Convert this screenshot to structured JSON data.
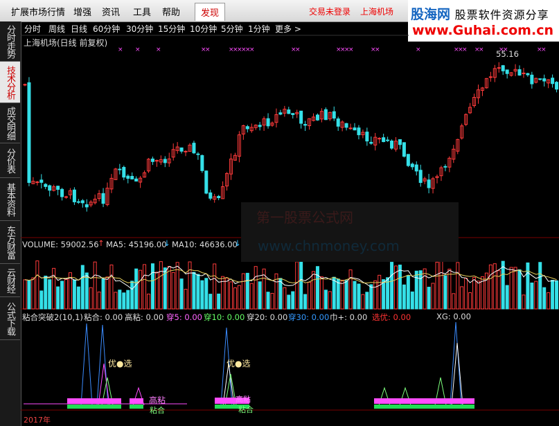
{
  "menu": {
    "items": [
      "扩展市场行情",
      "增强",
      "资讯",
      "工具",
      "帮助"
    ],
    "active": "发现",
    "links": [
      "交易未登录",
      "上海机场"
    ]
  },
  "logo": {
    "brand": "股海网",
    "tagline": "股票软件资源分享",
    "url": "www.Guhai.com.cn"
  },
  "sidebar": {
    "tabs": [
      "分时走势",
      "技术分析",
      "成交明细",
      "分价表",
      "基本资料",
      "东方财富",
      "云财经",
      "公式下载"
    ],
    "active_index": 1
  },
  "periods": {
    "items": [
      "分时",
      "周线",
      "日线",
      "60分钟",
      "30分钟",
      "15分钟",
      "10分钟",
      "5分钟",
      "1分钟",
      "更多 >"
    ],
    "active_index": 0
  },
  "chart": {
    "title": "上海机场(日线 前复权)",
    "high_label": "55.16",
    "colors": {
      "up": "#ff3b3b",
      "down": "#35e0e8",
      "ma5": "#ffffff",
      "ma10": "#e6cf5a",
      "signal": "#ff4dff"
    }
  },
  "volume": {
    "label": "VOLUME: 59002.56",
    "ma5": "MA5: 45196.00",
    "ma10": "MA10: 46636.00"
  },
  "indicator": {
    "name": "粘合突破2(10,1)",
    "items": [
      {
        "label": "粘合: 0.00",
        "color": "#dddddd"
      },
      {
        "label": "高粘: 0.00",
        "color": "#dddddd"
      },
      {
        "label": "穿5: 0.00",
        "color": "#ff66ff"
      },
      {
        "label": "穿10: 0.00",
        "color": "#66ff66"
      },
      {
        "label": "穿20: 0.00",
        "color": "#dddddd"
      },
      {
        "label": "穿30: 0.00",
        "color": "#3399ff"
      },
      {
        "label": "巾+: 0.00",
        "color": "#dddddd"
      },
      {
        "label": "选优: 0.00",
        "color": "#ff3333"
      },
      {
        "label": "XG: 0.00",
        "color": "#dddddd"
      }
    ],
    "annotations": [
      "优●选",
      "优●选",
      "高粘",
      "粘合",
      "粘合",
      "高粘"
    ]
  },
  "axis": {
    "year_label": "2017年"
  },
  "watermark": {
    "line1": "第一股票公式网",
    "line2": "www.chnmoney.com"
  }
}
